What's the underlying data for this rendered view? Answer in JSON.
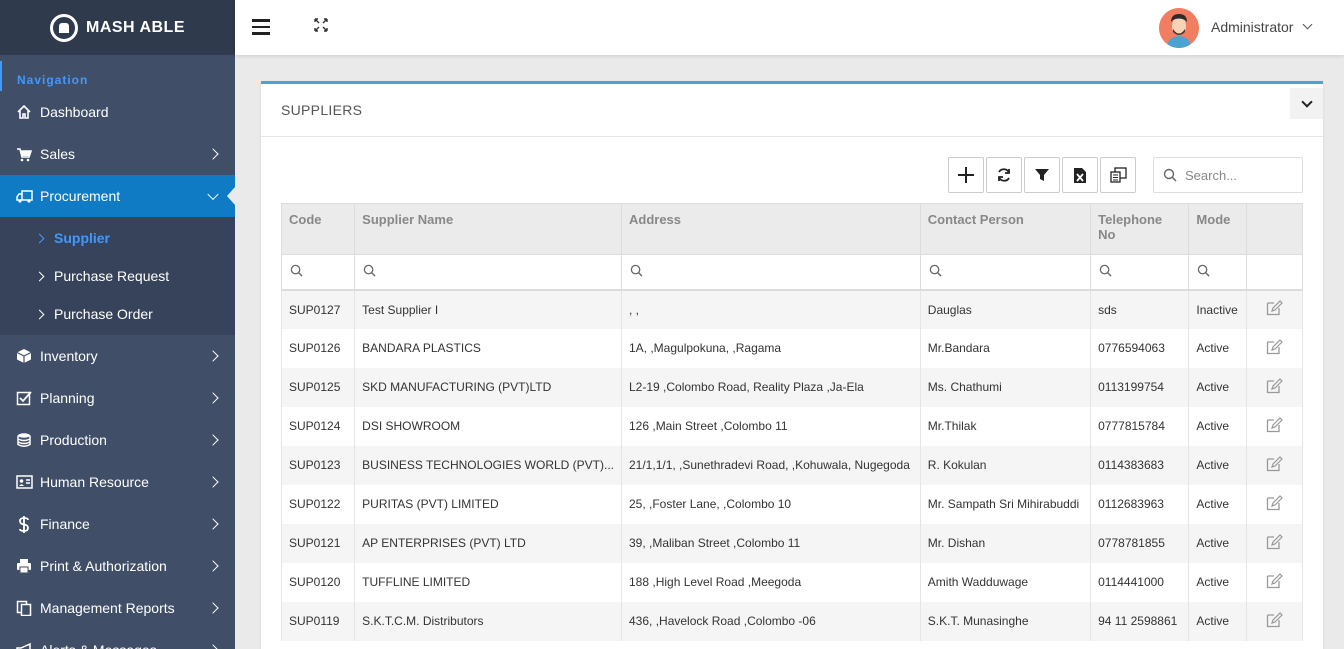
{
  "brand": {
    "name": "MASH ABLE"
  },
  "sidebar": {
    "section_label": "Navigation",
    "items": [
      {
        "label": "Dashboard",
        "icon": "home-icon",
        "has_children": false
      },
      {
        "label": "Sales",
        "icon": "cart-icon",
        "has_children": true
      },
      {
        "label": "Procurement",
        "icon": "truck-icon",
        "has_children": true,
        "active": true
      },
      {
        "label": "Inventory",
        "icon": "box-icon",
        "has_children": true
      },
      {
        "label": "Planning",
        "icon": "checkbox-icon",
        "has_children": true
      },
      {
        "label": "Production",
        "icon": "database-icon",
        "has_children": true
      },
      {
        "label": "Human Resource",
        "icon": "id-card-icon",
        "has_children": true
      },
      {
        "label": "Finance",
        "icon": "dollar-icon",
        "has_children": true
      },
      {
        "label": "Print & Authorization",
        "icon": "print-icon",
        "has_children": true
      },
      {
        "label": "Management Reports",
        "icon": "copy-icon",
        "has_children": true
      },
      {
        "label": "Alerts & Messages",
        "icon": "megaphone-icon",
        "has_children": true
      }
    ],
    "submenu": [
      {
        "label": "Supplier",
        "active": true
      },
      {
        "label": "Purchase Request"
      },
      {
        "label": "Purchase Order"
      }
    ]
  },
  "header": {
    "user_name": "Administrator"
  },
  "card": {
    "title": "SUPPLIERS",
    "search_placeholder": "Search..."
  },
  "table": {
    "columns": [
      "Code",
      "Supplier Name",
      "Address",
      "Contact Person",
      "Telephone No",
      "Mode",
      ""
    ],
    "rows": [
      {
        "code": "SUP0127",
        "name": "Test Supplier I",
        "address": ", ,",
        "contact": "Dauglas",
        "phone": "sds",
        "mode": "Inactive"
      },
      {
        "code": "SUP0126",
        "name": "BANDARA PLASTICS",
        "address": "1A, ,Magulpokuna, ,Ragama",
        "contact": "Mr.Bandara",
        "phone": "0776594063",
        "mode": "Active"
      },
      {
        "code": "SUP0125",
        "name": "SKD MANUFACTURING (PVT)LTD",
        "address": "L2-19 ,Colombo Road, Reality Plaza ,Ja-Ela",
        "contact": "Ms. Chathumi",
        "phone": "0113199754",
        "mode": "Active"
      },
      {
        "code": "SUP0124",
        "name": "DSI SHOWROOM",
        "address": "126 ,Main Street ,Colombo 11",
        "contact": "Mr.Thilak",
        "phone": "0777815784",
        "mode": "Active"
      },
      {
        "code": "SUP0123",
        "name": "BUSINESS TECHNOLOGIES WORLD (PVT)...",
        "address": "21/1,1/1, ,Sunethradevi Road, ,Kohuwala, Nugegoda",
        "contact": "R. Kokulan",
        "phone": "0114383683",
        "mode": "Active"
      },
      {
        "code": "SUP0122",
        "name": "PURITAS (PVT) LIMITED",
        "address": "25, ,Foster Lane, ,Colombo 10",
        "contact": "Mr. Sampath Sri Mihirabuddi",
        "phone": "0112683963",
        "mode": "Active"
      },
      {
        "code": "SUP0121",
        "name": "AP ENTERPRISES (PVT) LTD",
        "address": "39, ,Maliban Street ,Colombo 11",
        "contact": "Mr. Dishan",
        "phone": "0778781855",
        "mode": "Active"
      },
      {
        "code": "SUP0120",
        "name": "TUFFLINE LIMITED",
        "address": "188 ,High Level Road ,Meegoda",
        "contact": "Amith Wadduwage",
        "phone": "0114441000",
        "mode": "Active"
      },
      {
        "code": "SUP0119",
        "name": "S.K.T.C.M. Distributors",
        "address": "436, ,Havelock Road ,Colombo -06",
        "contact": "S.K.T. Munasinghe",
        "phone": "94 11 2598861",
        "mode": "Active"
      }
    ]
  },
  "colors": {
    "sidebar_bg": "#404e67",
    "active_blue": "#0e7bc4",
    "accent": "#4099ff",
    "active_status": "#2ec13a",
    "inactive_status": "#e4433f"
  }
}
